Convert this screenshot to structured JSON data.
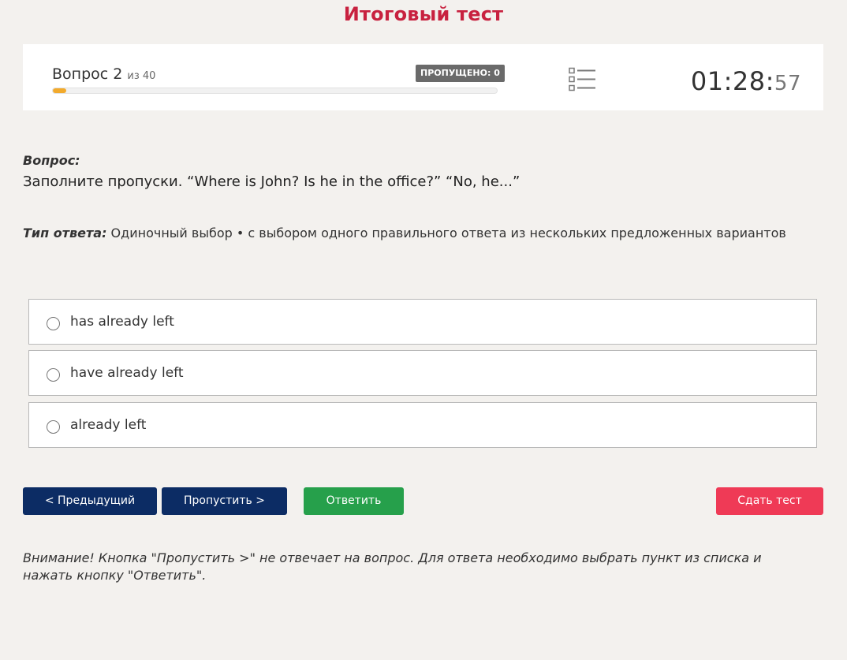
{
  "header": {
    "title": "Итоговый тест"
  },
  "status": {
    "question_label": "Вопрос 2",
    "question_total": "из 40",
    "skipped_badge": "ПРОПУЩЕНО: 0",
    "progress_fraction": 0.03,
    "progress_color": "#f2aa2c",
    "list_icon": "list-icon",
    "timer_main": "01:28:",
    "timer_seconds": "57"
  },
  "question": {
    "label": "Вопрос:",
    "text": "Заполните пропуски. “Where is John? Is he in the office?” “No, he...”",
    "answer_type_label": "Тип ответа:",
    "answer_type_value": " Одиночный выбор • с выбором одного правильного ответа из нескольких предложенных вариантов"
  },
  "options": [
    {
      "label": "has already left"
    },
    {
      "label": "have already left"
    },
    {
      "label": "already left"
    }
  ],
  "buttons": {
    "prev": "< Предыдущий",
    "skip": "Пропустить >",
    "answer": "Ответить",
    "submit": "Сдать тест"
  },
  "colors": {
    "title": "#c8213f",
    "nav_button": "#0c2c64",
    "answer_button": "#26a04b",
    "submit_button": "#ef3a56"
  },
  "notice": "Внимание! Кнопка \"Пропустить >\" не отвечает на вопрос. Для ответа необходимо выбрать пункт из списка и нажать кнопку \"Ответить\"."
}
